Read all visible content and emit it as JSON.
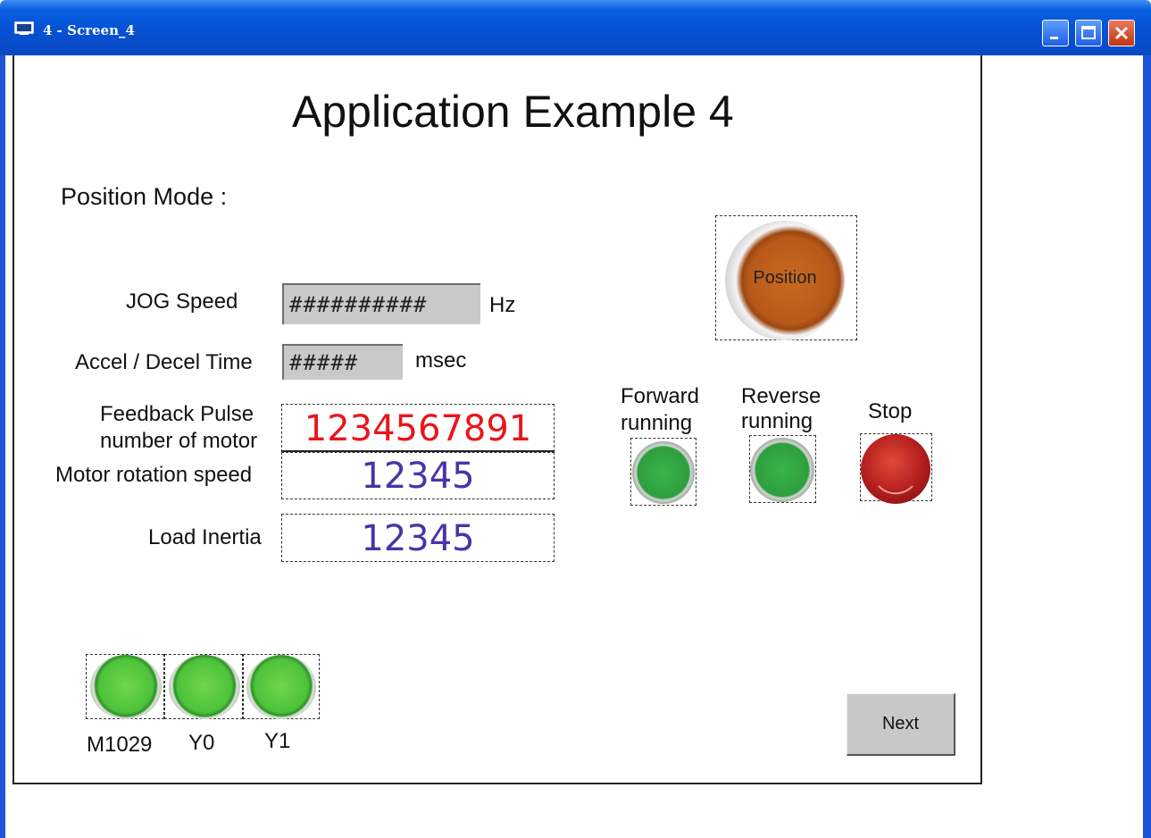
{
  "window": {
    "title": "4 - Screen_4"
  },
  "page": {
    "title": "Application Example 4",
    "mode_label": "Position Mode :"
  },
  "jog": {
    "label": "JOG Speed",
    "value": "##########",
    "unit": "Hz"
  },
  "accel": {
    "label": "Accel / Decel Time",
    "value": "#####",
    "unit": "msec"
  },
  "feedback": {
    "label_line1": "Feedback Pulse",
    "label_line2": "number of motor",
    "value": "1234567891",
    "color": "#e8151b"
  },
  "rotation": {
    "label": "Motor rotation speed",
    "value": "12345",
    "color": "#4a33a8"
  },
  "inertia": {
    "label": "Load Inertia",
    "value": "12345",
    "color": "#4a33a8"
  },
  "position_button": {
    "label": "Position"
  },
  "status": {
    "forward": {
      "line1": "Forward",
      "line2": "running"
    },
    "reverse": {
      "line1": "Reverse",
      "line2": "running"
    },
    "stop": {
      "label": "Stop"
    }
  },
  "indicators": [
    {
      "label": "M1029"
    },
    {
      "label": "Y0"
    },
    {
      "label": "Y1"
    }
  ],
  "next_button": {
    "label": "Next"
  },
  "icons": [
    "window-icon",
    "minimize-icon",
    "maximize-icon",
    "close-icon"
  ]
}
